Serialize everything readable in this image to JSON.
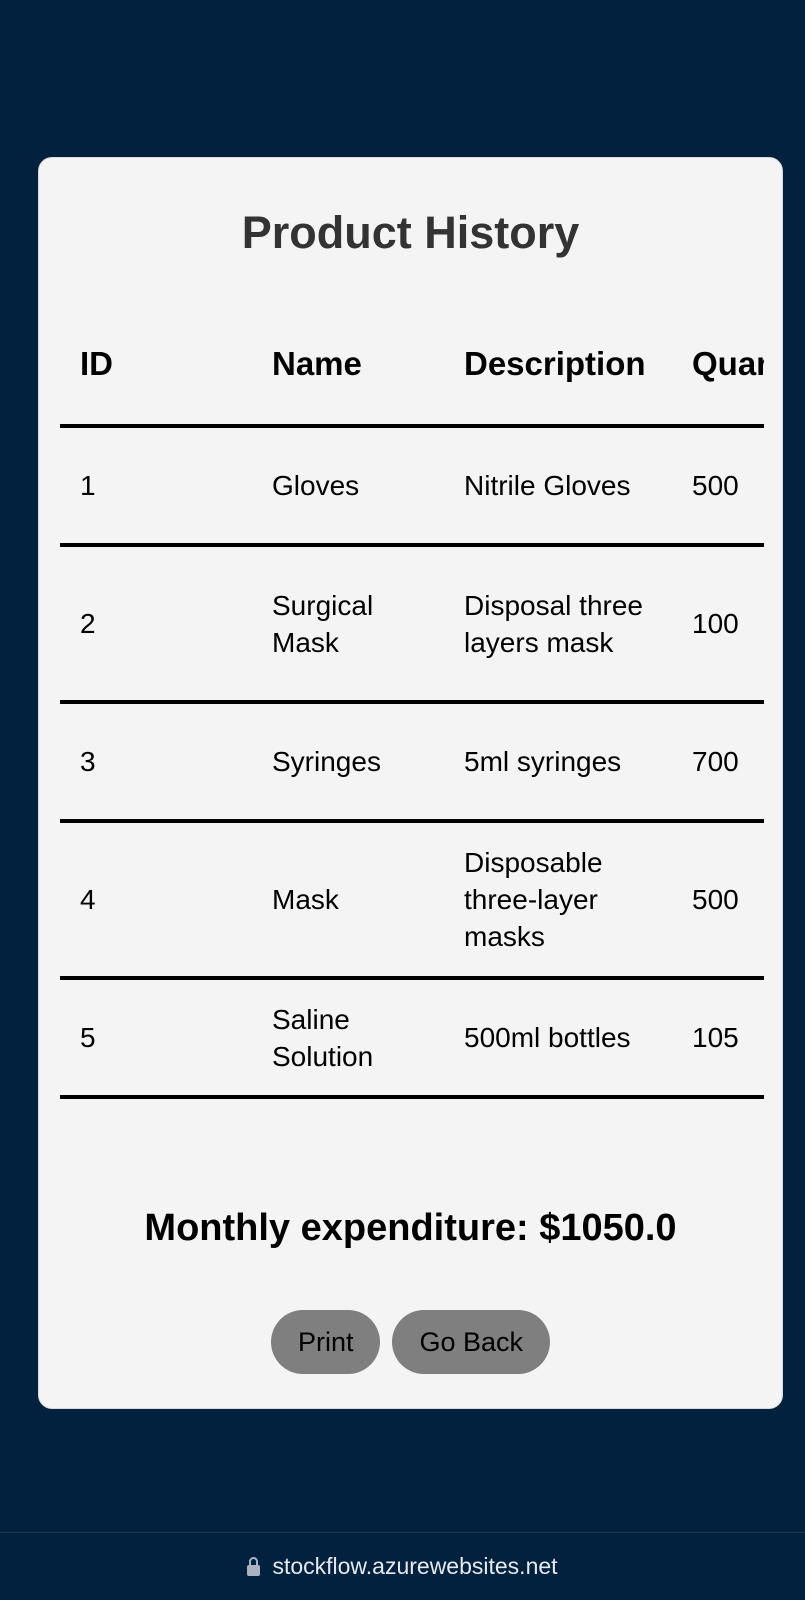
{
  "page": {
    "title": "Product History"
  },
  "table": {
    "headers": [
      "ID",
      "Name",
      "Description",
      "Quantity"
    ],
    "rows": [
      {
        "id": "1",
        "name": "Gloves",
        "description": "Nitrile Gloves",
        "quantity": "500"
      },
      {
        "id": "2",
        "name": "Surgical Mask",
        "description": "Disposal three layers mask",
        "quantity": "100"
      },
      {
        "id": "3",
        "name": "Syringes",
        "description": "5ml syringes",
        "quantity": "700"
      },
      {
        "id": "4",
        "name": "Mask",
        "description": "Disposable three-layer masks",
        "quantity": "500"
      },
      {
        "id": "5",
        "name": "Saline Solution",
        "description": "500ml bottles",
        "quantity": "105"
      }
    ]
  },
  "summary": {
    "expenditure": "Monthly expenditure: $1050.0"
  },
  "actions": {
    "print_label": "Print",
    "back_label": "Go Back"
  },
  "browser": {
    "url": "stockflow.azurewebsites.net"
  },
  "colors": {
    "background": "#01213f",
    "card": "#f4f4f4",
    "button": "#7f7f7f"
  }
}
